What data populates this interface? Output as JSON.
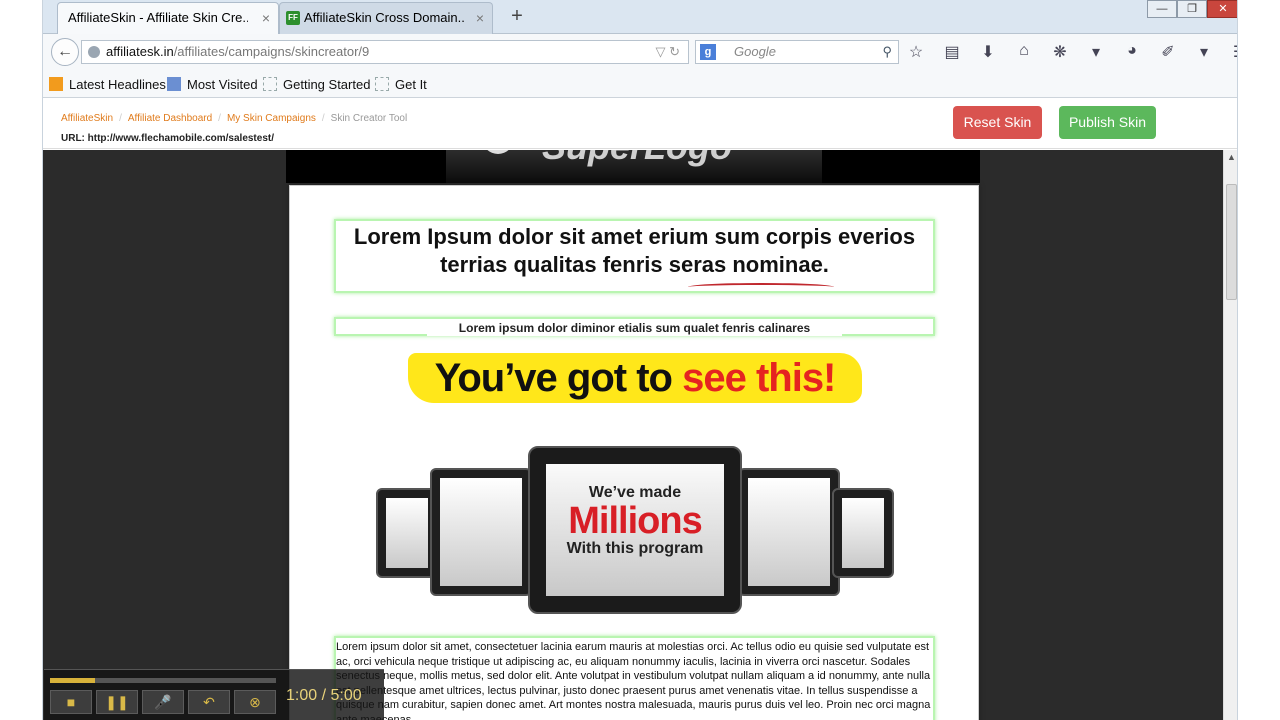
{
  "browser": {
    "tabs": [
      {
        "label": "AffiliateSkin - Affiliate Skin Cre...",
        "active": true
      },
      {
        "label": "AffiliateSkin Cross Domain...",
        "active": false
      }
    ],
    "tab_close_glyph": "×",
    "new_tab_glyph": "+",
    "window_controls": [
      "—",
      "❐",
      "✕"
    ],
    "url": {
      "host": "affiliatesk.in",
      "path": "/affiliates/campaigns/skincreator/9"
    },
    "search_placeholder": "Google",
    "search_engine_letter": "g"
  },
  "bookmarks": [
    {
      "label": "Latest Headlines",
      "icon": "rss-icon"
    },
    {
      "label": "Most Visited",
      "icon": "most-visited-icon"
    },
    {
      "label": "Getting Started",
      "icon": "bookmark-icon"
    },
    {
      "label": "Get It",
      "icon": "bookmark-icon"
    }
  ],
  "header": {
    "breadcrumb": [
      "AffiliateSkin",
      "Affiliate Dashboard",
      "My Skin Campaigns",
      "Skin Creator Tool"
    ],
    "url_line": "URL: http://www.flechamobile.com/salestest/",
    "reset_label": "Reset Skin",
    "publish_label": "Publish Skin",
    "colors": {
      "reset": "#d9534f",
      "publish": "#5cb85c",
      "link": "#e07b1c"
    }
  },
  "page": {
    "logo_text": "SuperLogo",
    "headline": "Lorem Ipsum dolor sit amet erium sum corpis everios terrias qualitas fenris seras nominae.",
    "subheadline": "Lorem ipsum dolor diminor etialis sum qualet fenris calinares",
    "banner_part1": "You’ve got to",
    "banner_part2": "see this!",
    "tablet_line1": "We’ve made",
    "tablet_line2": "Millions",
    "tablet_line3": "With this program",
    "body_text": "Lorem ipsum dolor sit amet, consectetuer lacinia earum mauris at molestias orci. Ac tellus odio eu quisie sed vulputate est ac, orci vehicula neque tristique ut adipiscing ac, eu aliquam nonummy iaculis, lacinia in viverra orci nascetur. Sodales senectus neque, mollis metus, sed dolor elit. Ante volutpat in vestibulum volutpat nullam aliquam a id nonummy, ante nulla est pellentesque amet ultrices, lectus pulvinar, justo donec praesent purus amet venenatis vitae. In tellus suspendisse a quisque nam curabitur, sapien donec amet. Art montes nostra malesuada, mauris purus duis vel leo. Proin nec orci magna ante maecenas."
  },
  "player": {
    "time": "1:00 / 5:00",
    "progress": 0.2
  }
}
